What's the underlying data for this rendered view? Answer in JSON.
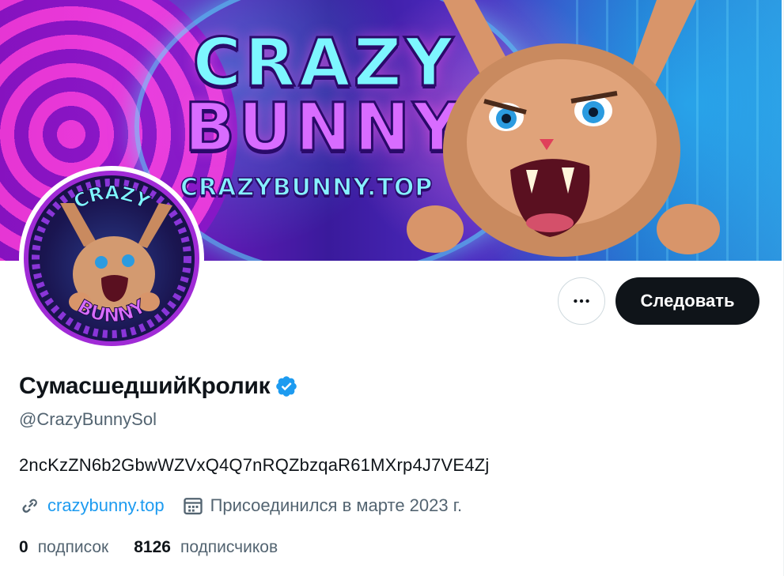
{
  "banner": {
    "title_line1": "CRAZY",
    "title_line2": "BUNNY",
    "url_text": "CRAZYBUNNY.TOP"
  },
  "avatar": {
    "top_text": "CRAZY",
    "bottom_text": "BUNNY"
  },
  "actions": {
    "more_label": "•••",
    "follow_label": "Следовать"
  },
  "profile": {
    "display_name": "СумасшедшийКролик",
    "handle": "@CrazyBunnySol",
    "bio": "2ncKzZN6b2GbwWZVxQ4Q7nRQZbzqaR61MXrp4J7VE4Zj",
    "website": "crazybunny.top",
    "joined": "Присоединился в марте 2023 г."
  },
  "stats": {
    "following_count": "0",
    "following_label": "подписок",
    "followers_count": "8126",
    "followers_label": "подписчиков"
  },
  "colors": {
    "accent": "#1d9bf0",
    "text_primary": "#0f1419",
    "text_secondary": "#536471",
    "follow_button_bg": "#0f1419",
    "verified_badge": "#1d9bf0"
  },
  "icons": {
    "more": "more-horizontal-icon",
    "verified": "verified-badge-icon",
    "link": "link-icon",
    "calendar": "calendar-icon"
  }
}
